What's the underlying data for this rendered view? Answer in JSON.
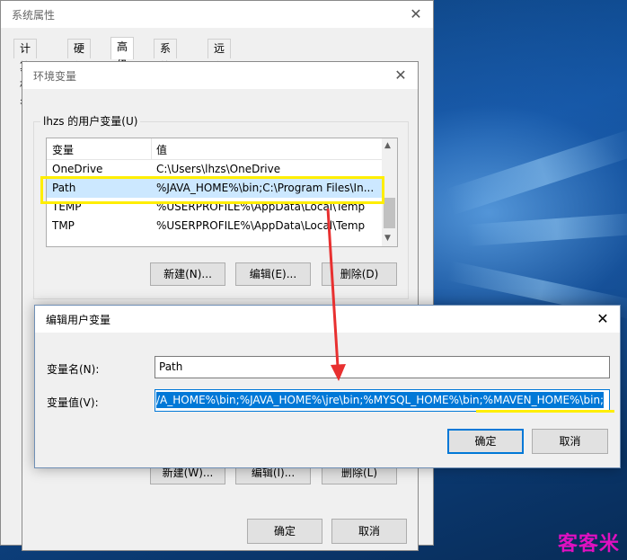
{
  "system_properties": {
    "title": "系统属性",
    "tabs": [
      "计算机名",
      "硬件",
      "高级",
      "系统保护",
      "远程"
    ],
    "active_tab": "高级"
  },
  "env_vars": {
    "title": "环境变量",
    "group_label": "lhzs 的用户变量(U)",
    "columns": [
      "变量",
      "值"
    ],
    "rows": [
      {
        "name": "OneDrive",
        "value": "C:\\Users\\lhzs\\OneDrive"
      },
      {
        "name": "Path",
        "value": "%JAVA_HOME%\\bin;C:\\Program Files\\In..."
      },
      {
        "name": "TEMP",
        "value": "%USERPROFILE%\\AppData\\Local\\Temp"
      },
      {
        "name": "TMP",
        "value": "%USERPROFILE%\\AppData\\Local\\Temp"
      }
    ],
    "user_buttons": {
      "new": "新建(N)...",
      "edit": "编辑(E)...",
      "delete": "删除(D)"
    },
    "system_buttons": {
      "new": "新建(W)...",
      "edit": "编辑(I)...",
      "delete": "删除(L)"
    },
    "ok": "确定",
    "cancel": "取消"
  },
  "edit_dialog": {
    "title": "编辑用户变量",
    "name_label": "变量名(N):",
    "name_value": "Path",
    "value_label": "变量值(V):",
    "value_value": "/A_HOME%\\bin;%JAVA_HOME%\\jre\\bin;%MYSQL_HOME%\\bin;%MAVEN_HOME%\\bin;",
    "ok": "确定",
    "cancel": "取消"
  },
  "watermark": "客客米",
  "colors": {
    "highlight": "#ffee00",
    "arrow": "#e83030",
    "selection": "#0078d7",
    "watermark": "#e010c0"
  }
}
